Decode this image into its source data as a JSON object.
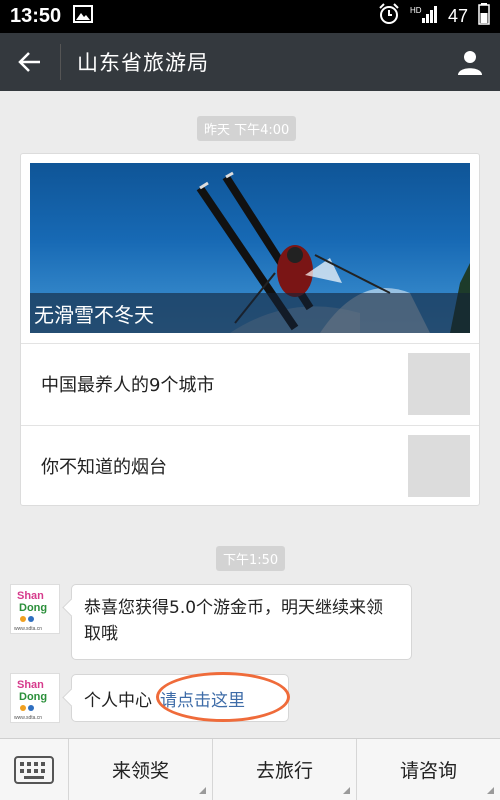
{
  "status_bar": {
    "time": "13:50",
    "battery": "47",
    "icons": [
      "image-icon",
      "alarm-icon",
      "hd-signal-icon",
      "battery-icon"
    ]
  },
  "header": {
    "title": "山东省旅游局",
    "back_icon": "back-arrow-icon",
    "profile_icon": "user-profile-icon"
  },
  "messages": {
    "timestamp_1": "昨天 下午4:00",
    "article_card": {
      "hero_title": "无滑雪不冬天",
      "items": [
        {
          "title": "中国最养人的9个城市"
        },
        {
          "title": "你不知道的烟台"
        }
      ]
    },
    "timestamp_2": "下午1:50",
    "bubble_1": "恭喜您获得5.0个游金币，明天继续来领取哦",
    "bubble_2": {
      "text": "个人中心",
      "link": "请点击这里"
    },
    "avatar_logo": {
      "line1": "Shan",
      "line2": "Dong",
      "caption": "www.sdta.cn"
    }
  },
  "bottom_menu": {
    "keyboard_icon": "keyboard-icon",
    "items": [
      {
        "label": "来领奖"
      },
      {
        "label": "去旅行"
      },
      {
        "label": "请咨询"
      }
    ]
  },
  "colors": {
    "title_bar": "#34393e",
    "link": "#3e6ca8",
    "highlight_oval": "#ef6b3a"
  }
}
